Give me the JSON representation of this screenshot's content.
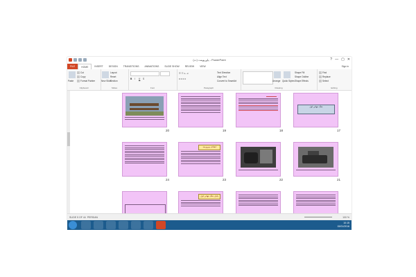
{
  "window": {
    "title": "(ت) پاورپوینت - PowerPoint",
    "controls": [
      "?",
      "—",
      "▢",
      "✕"
    ]
  },
  "tabs": [
    "FILE",
    "HOME",
    "INSERT",
    "DESIGN",
    "TRANSITIONS",
    "ANIMATIONS",
    "SLIDE SHOW",
    "REVIEW",
    "VIEW"
  ],
  "active_tab": "HOME",
  "signin": "Sign in",
  "ribbon": {
    "clipboard": {
      "label": "Clipboard",
      "paste": "Paste",
      "cut": "Cut",
      "copy": "Copy",
      "format_painter": "Format Painter"
    },
    "slides": {
      "label": "Slides",
      "new_slide": "New Slide",
      "layout": "Layout",
      "reset": "Reset",
      "section": "Section"
    },
    "font": {
      "label": "Font"
    },
    "paragraph": {
      "label": "Paragraph",
      "text_direction": "Text Direction",
      "align_text": "Align Text",
      "convert_smartart": "Convert to SmartArt"
    },
    "drawing": {
      "label": "Drawing",
      "arrange": "Arrange",
      "quick_styles": "Quick Styles",
      "shape_fill": "Shape Fill",
      "shape_outline": "Shape Outline",
      "shape_effects": "Shape Effects"
    },
    "editing": {
      "label": "Editing",
      "find": "Find",
      "replace": "Replace",
      "select": "Select"
    }
  },
  "slides": {
    "s17": "17",
    "s18": "18",
    "s19": "19",
    "s20": "20",
    "s21": "21",
    "s22": "22",
    "s23": "23",
    "s24": "24",
    "t17": "جنگ جهانی اول",
    "t23": "اهداف پیروزمند",
    "t_bottom": "پایان جنگ جهانی اول"
  },
  "status": {
    "slide": "SLIDE 5 OF 44",
    "lang": "PERSIAN",
    "zoom": "100 %"
  },
  "taskbar": {
    "time": "10:15",
    "date": "15/01/2016"
  }
}
